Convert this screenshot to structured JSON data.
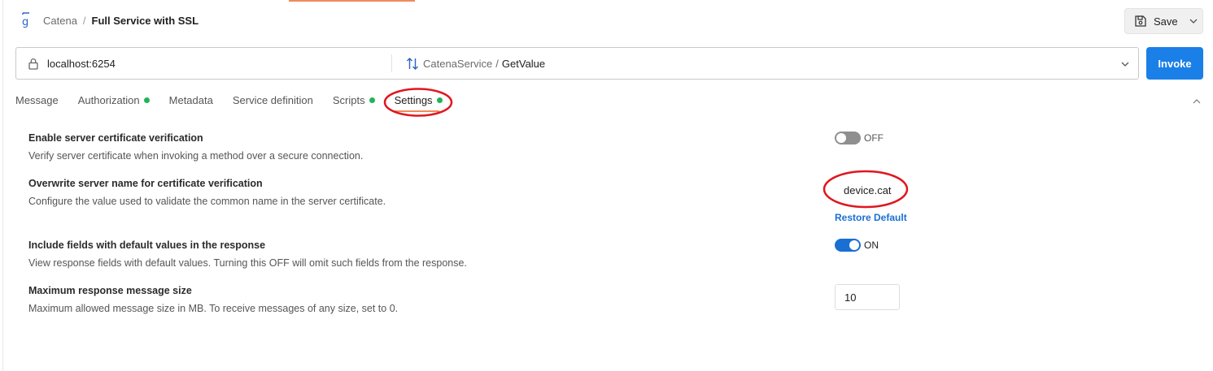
{
  "header": {
    "breadcrumb_collection": "Catena",
    "breadcrumb_separator": "/",
    "request_title": "Full Service with SSL",
    "save_label": "Save"
  },
  "urlbar": {
    "host": "localhost:6254",
    "service": "CatenaService",
    "separator": "/",
    "method": "GetValue",
    "invoke_label": "Invoke"
  },
  "tabs": [
    {
      "label": "Message",
      "has_dot": false
    },
    {
      "label": "Authorization",
      "has_dot": true
    },
    {
      "label": "Metadata",
      "has_dot": false
    },
    {
      "label": "Service definition",
      "has_dot": false
    },
    {
      "label": "Scripts",
      "has_dot": true
    },
    {
      "label": "Settings",
      "has_dot": true,
      "active": true
    }
  ],
  "settings": {
    "cert_verification": {
      "title": "Enable server certificate verification",
      "description": "Verify server certificate when invoking a method over a secure connection.",
      "state": "OFF"
    },
    "server_name": {
      "title": "Overwrite server name for certificate verification",
      "description": "Configure the value used to validate the common name in the server certificate.",
      "value": "device.cat",
      "restore_label": "Restore Default"
    },
    "default_values": {
      "title": "Include fields with default values in the response",
      "description": "View response fields with default values. Turning this OFF will omit such fields from the response.",
      "state": "ON"
    },
    "max_message_size": {
      "title": "Maximum response message size",
      "description": "Maximum allowed message size in MB. To receive messages of any size, set to 0.",
      "value": "10"
    }
  },
  "colors": {
    "accent_blue": "#1a7fe6",
    "toggle_on": "#1a6fd3",
    "status_dot": "#22b35a",
    "active_tab_underline": "#f08a5d",
    "annotation_red": "#e0161e"
  }
}
